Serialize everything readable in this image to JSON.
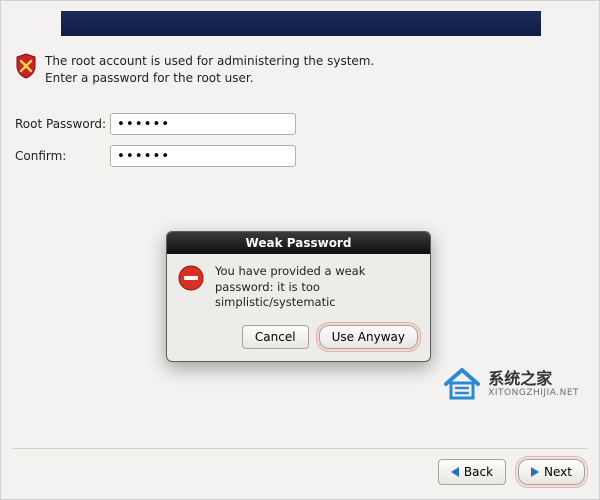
{
  "intro_text": "The root account is used for administering the system.  Enter a password for the root user.",
  "form": {
    "root_password_label": "Root Password:",
    "root_password_value": "••••••",
    "confirm_label": "Confirm:",
    "confirm_value": "••••••"
  },
  "dialog": {
    "title": "Weak Password",
    "message": "You have provided a weak password: it is too simplistic/systematic",
    "cancel_label": "Cancel",
    "use_anyway_label": "Use Anyway"
  },
  "watermark": {
    "title_zh": "系统之家",
    "subtitle_en": "XITONGZHIJIA.NET"
  },
  "nav": {
    "back_label": "Back",
    "next_label": "Next"
  }
}
